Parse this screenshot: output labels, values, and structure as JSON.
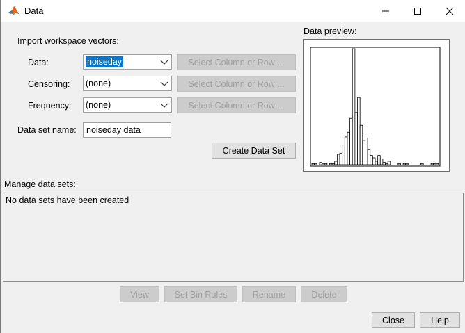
{
  "window": {
    "title": "Data",
    "icon": "matlab-logo-icon",
    "controls": {
      "minimize": "—",
      "maximize": "☐",
      "close": "✕"
    }
  },
  "import": {
    "heading": "Import workspace vectors:",
    "data_label": "Data:",
    "data_value": "noiseday",
    "censoring_label": "Censoring:",
    "censoring_value": "(none)",
    "frequency_label": "Frequency:",
    "frequency_value": "(none)",
    "select_button": "Select Column or Row ...",
    "dataset_name_label": "Data set name:",
    "dataset_name_value": "noiseday data",
    "create_button": "Create Data Set"
  },
  "preview": {
    "label": "Data preview:",
    "histogram_counts": [
      1,
      1,
      0,
      2,
      1,
      1,
      0,
      1,
      1,
      3,
      9,
      10,
      17,
      24,
      28,
      40,
      100,
      45,
      58,
      34,
      21,
      23,
      13,
      8,
      6,
      3,
      8,
      5,
      2,
      1,
      3,
      0,
      0,
      0,
      1,
      0,
      1,
      1,
      0,
      0,
      0,
      0,
      0,
      1,
      0,
      0,
      0,
      1,
      1,
      1
    ]
  },
  "manage": {
    "heading": "Manage data sets:",
    "empty_message": "No data sets have been created",
    "buttons": {
      "view": "View",
      "set_bin_rules": "Set Bin Rules",
      "rename": "Rename",
      "delete": "Delete"
    }
  },
  "footer": {
    "close": "Close",
    "help": "Help"
  }
}
